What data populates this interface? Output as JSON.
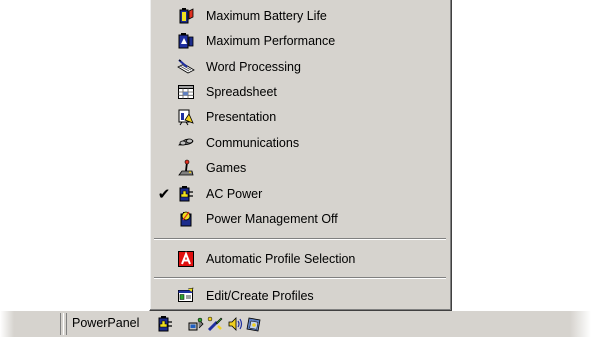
{
  "menu": {
    "items": [
      {
        "label": "Maximum Battery Life",
        "icon": "battery-life-icon",
        "checked": false
      },
      {
        "label": "Maximum Performance",
        "icon": "performance-icon",
        "checked": false
      },
      {
        "label": "Word Processing",
        "icon": "word-processing-icon",
        "checked": false
      },
      {
        "label": "Spreadsheet",
        "icon": "spreadsheet-icon",
        "checked": false
      },
      {
        "label": "Presentation",
        "icon": "presentation-icon",
        "checked": false
      },
      {
        "label": "Communications",
        "icon": "communications-icon",
        "checked": false
      },
      {
        "label": "Games",
        "icon": "joystick-icon",
        "checked": false
      },
      {
        "label": "AC Power",
        "icon": "ac-power-icon",
        "checked": true
      },
      {
        "label": "Power Management Off",
        "icon": "power-off-icon",
        "checked": false
      }
    ],
    "auto_profile": {
      "label": "Automatic Profile Selection",
      "icon": "auto-profile-icon"
    },
    "edit_profiles": {
      "label": "Edit/Create Profiles",
      "icon": "edit-profiles-icon"
    },
    "check_mark": "✔"
  },
  "taskbar": {
    "label": "PowerPanel",
    "tray_icons": [
      "powerpanel-tray-icon",
      "network-tray-icon",
      "tool-tray-icon",
      "volume-tray-icon",
      "display-tray-icon"
    ]
  },
  "colors": {
    "menu_bg": "#d6d3ce",
    "auto_profile_red": "#e01010"
  }
}
